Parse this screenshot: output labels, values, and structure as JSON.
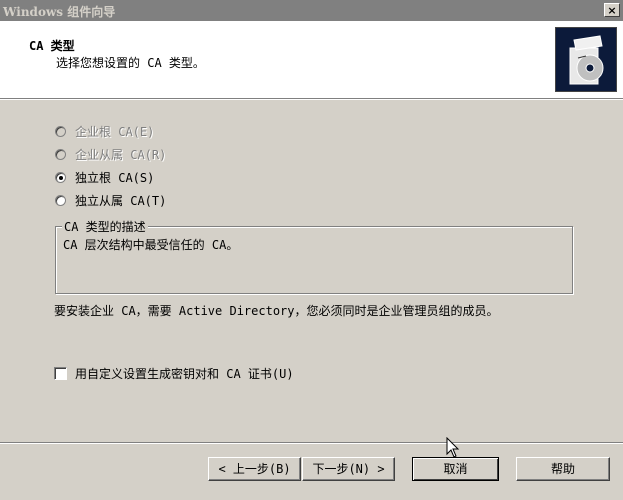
{
  "window": {
    "title": "Windows 组件向导",
    "close_label": "×"
  },
  "header": {
    "title": "CA 类型",
    "subtitle": "选择您想设置的 CA 类型。"
  },
  "ca_types": [
    {
      "label": "企业根 CA(E)",
      "enabled": false,
      "checked": false
    },
    {
      "label": "企业从属 CA(R)",
      "enabled": false,
      "checked": false
    },
    {
      "label": "独立根 CA(S)",
      "enabled": true,
      "checked": true
    },
    {
      "label": "独立从属 CA(T)",
      "enabled": true,
      "checked": false
    }
  ],
  "description": {
    "legend": "CA 类型的描述",
    "text": "CA 层次结构中最受信任的 CA。"
  },
  "note": "要安装企业 CA，需要 Active Directory，您必须同时是企业管理员组的成员。",
  "custom_keys": {
    "label": "用自定义设置生成密钥对和 CA 证书(U)",
    "checked": false
  },
  "buttons": {
    "back": "< 上一步(B)",
    "next": "下一步(N) >",
    "cancel": "取消",
    "help": "帮助"
  },
  "colors": {
    "title_bar": "#808080",
    "face": "#d4d0c8",
    "header_bg": "#ffffff"
  }
}
